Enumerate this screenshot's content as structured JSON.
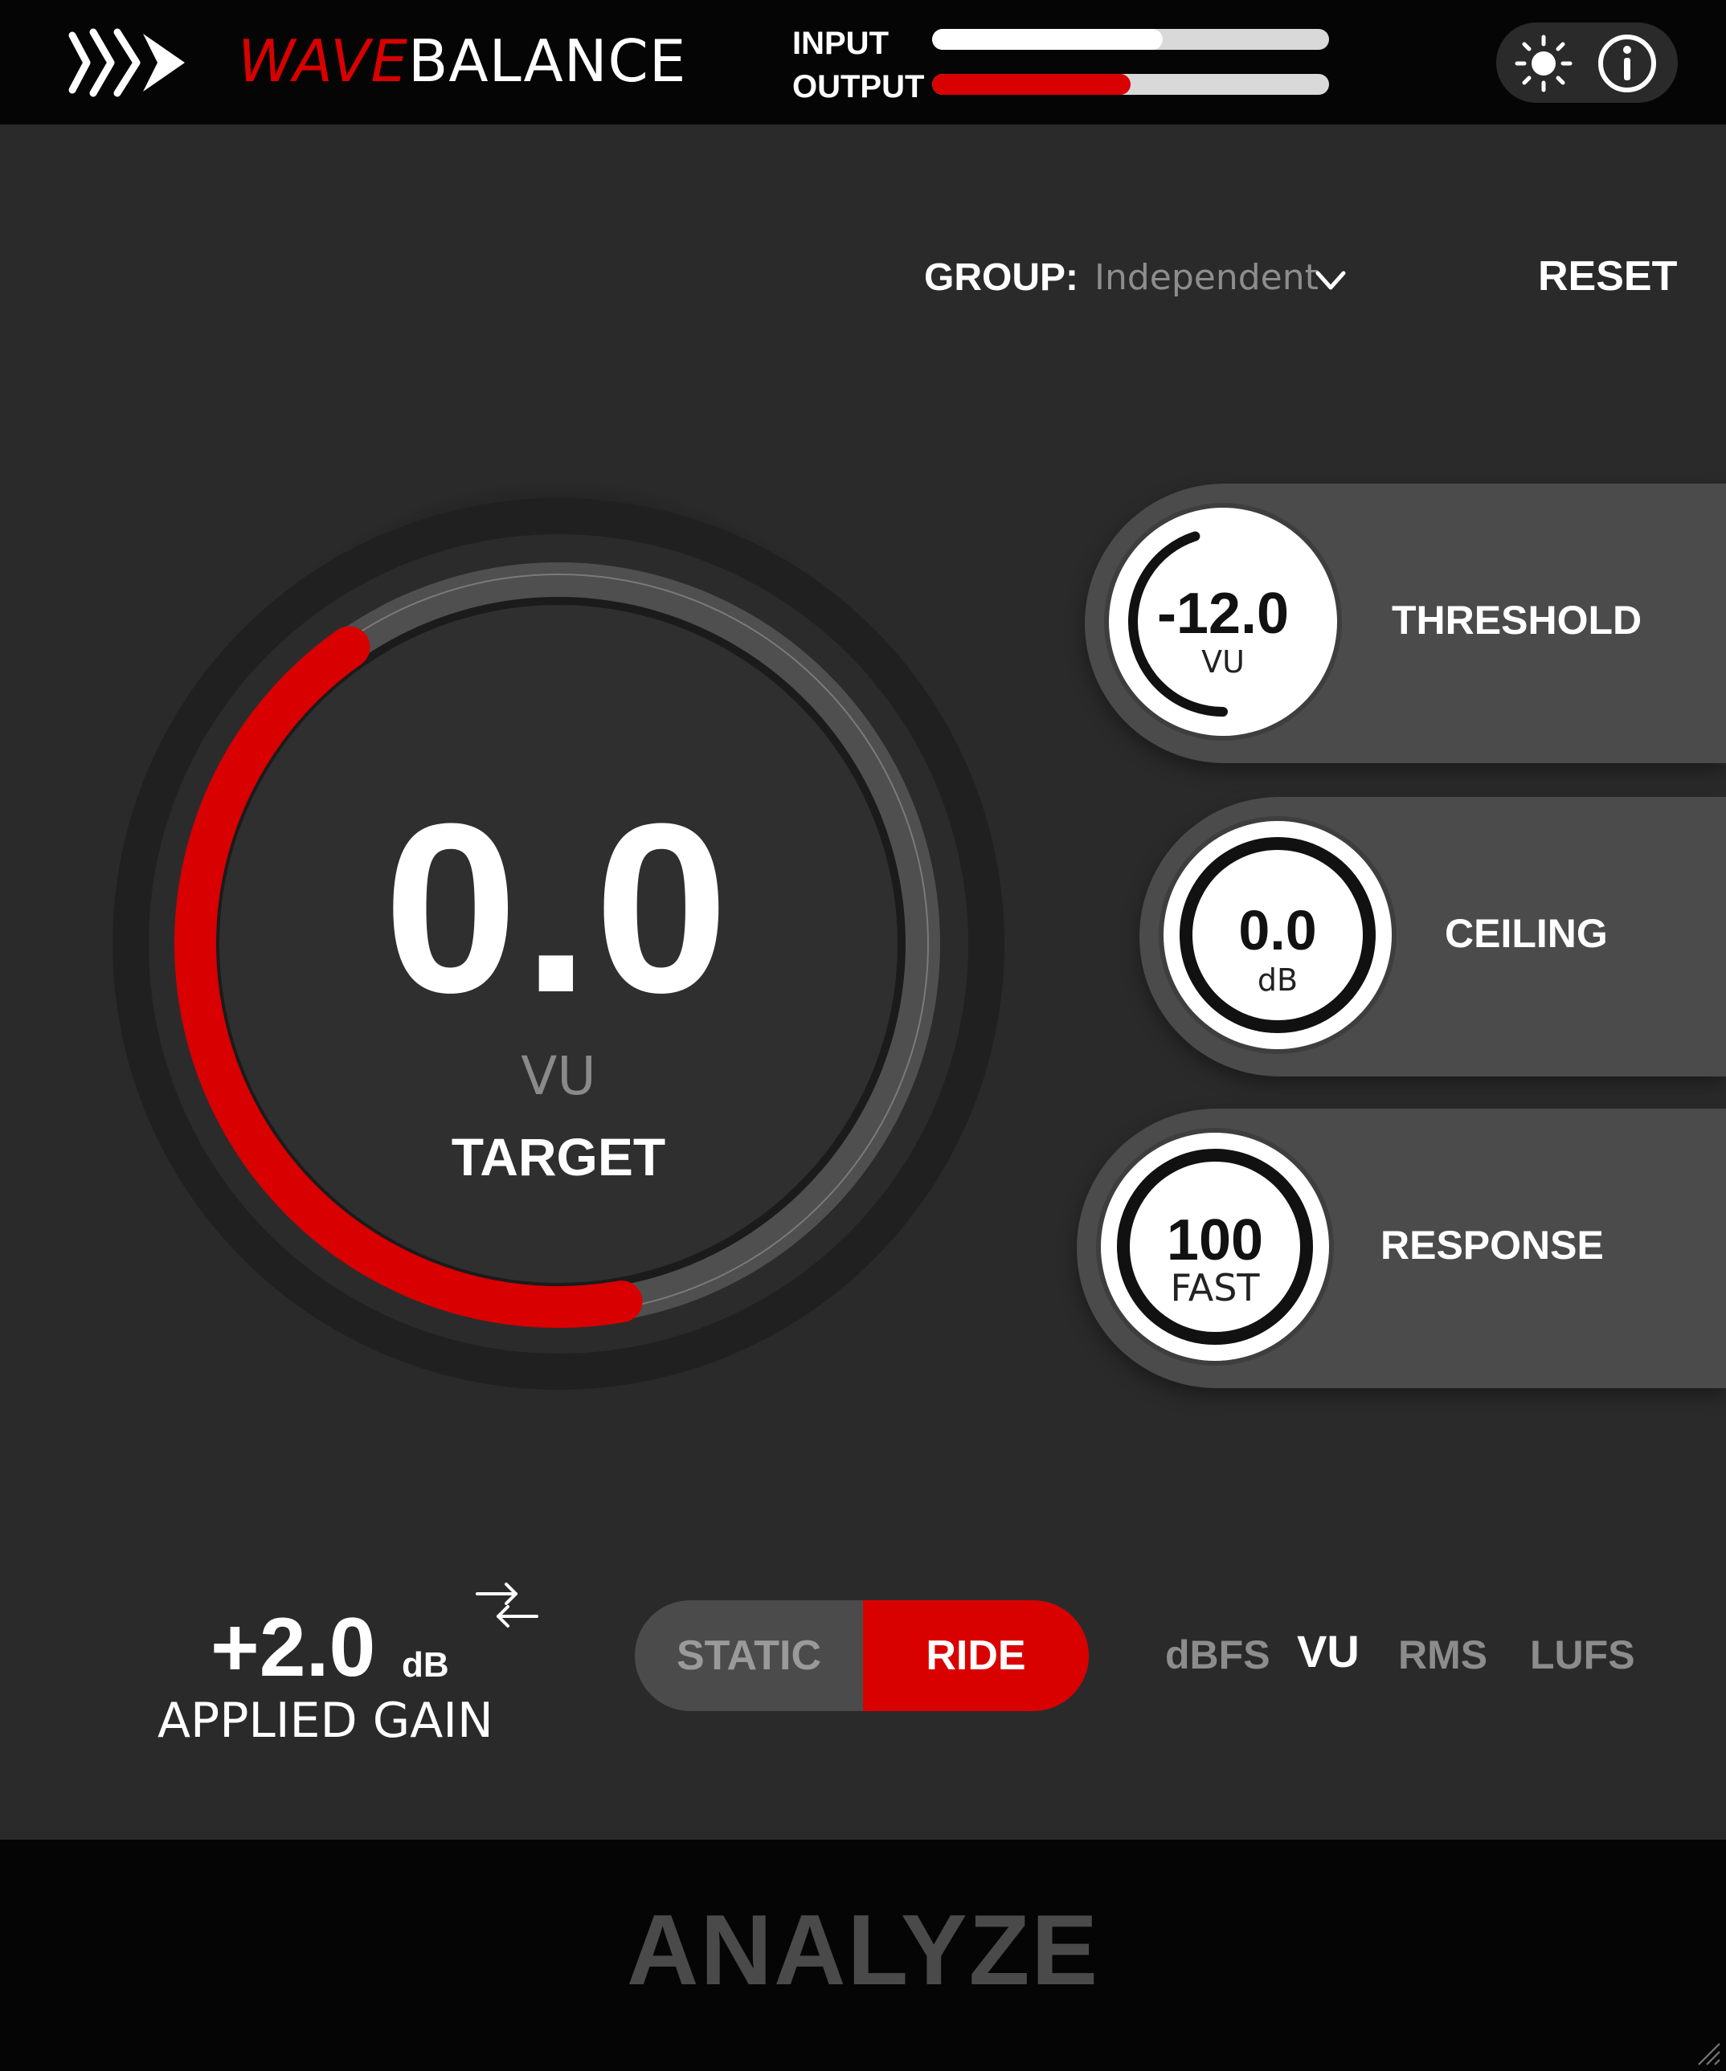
{
  "app": {
    "brand_wave": "WAVE",
    "brand_balance": "BALANCE",
    "accent_color": "#d90000"
  },
  "header": {
    "input_label": "INPUT",
    "output_label": "OUTPUT",
    "input_level": 0.58,
    "output_level": 0.5,
    "icons": [
      "logo-icon",
      "sun-icon",
      "info-icon"
    ]
  },
  "group": {
    "label": "GROUP:",
    "value": "Independent"
  },
  "reset_label": "RESET",
  "target": {
    "value": "0.0",
    "unit": "VU",
    "label": "TARGET",
    "arc_fraction": 0.43
  },
  "threshold": {
    "value": "-12.0",
    "unit": "VU",
    "label": "THRESHOLD",
    "arc_fraction": 0.6
  },
  "ceiling": {
    "value": "0.0",
    "unit": "dB",
    "label": "CEILING",
    "arc_fraction": 1.0
  },
  "response": {
    "value": "100",
    "unit": "FAST",
    "label": "RESPONSE",
    "arc_fraction": 1.0
  },
  "applied_gain": {
    "value": "+2.0",
    "unit": "dB",
    "label": "APPLIED GAIN"
  },
  "mode": {
    "static_label": "STATIC",
    "ride_label": "RIDE",
    "selected": "RIDE"
  },
  "scale": {
    "options": [
      "dBFS",
      "VU",
      "RMS",
      "LUFS"
    ],
    "selected": "VU"
  },
  "analyze_label": "ANALYZE"
}
